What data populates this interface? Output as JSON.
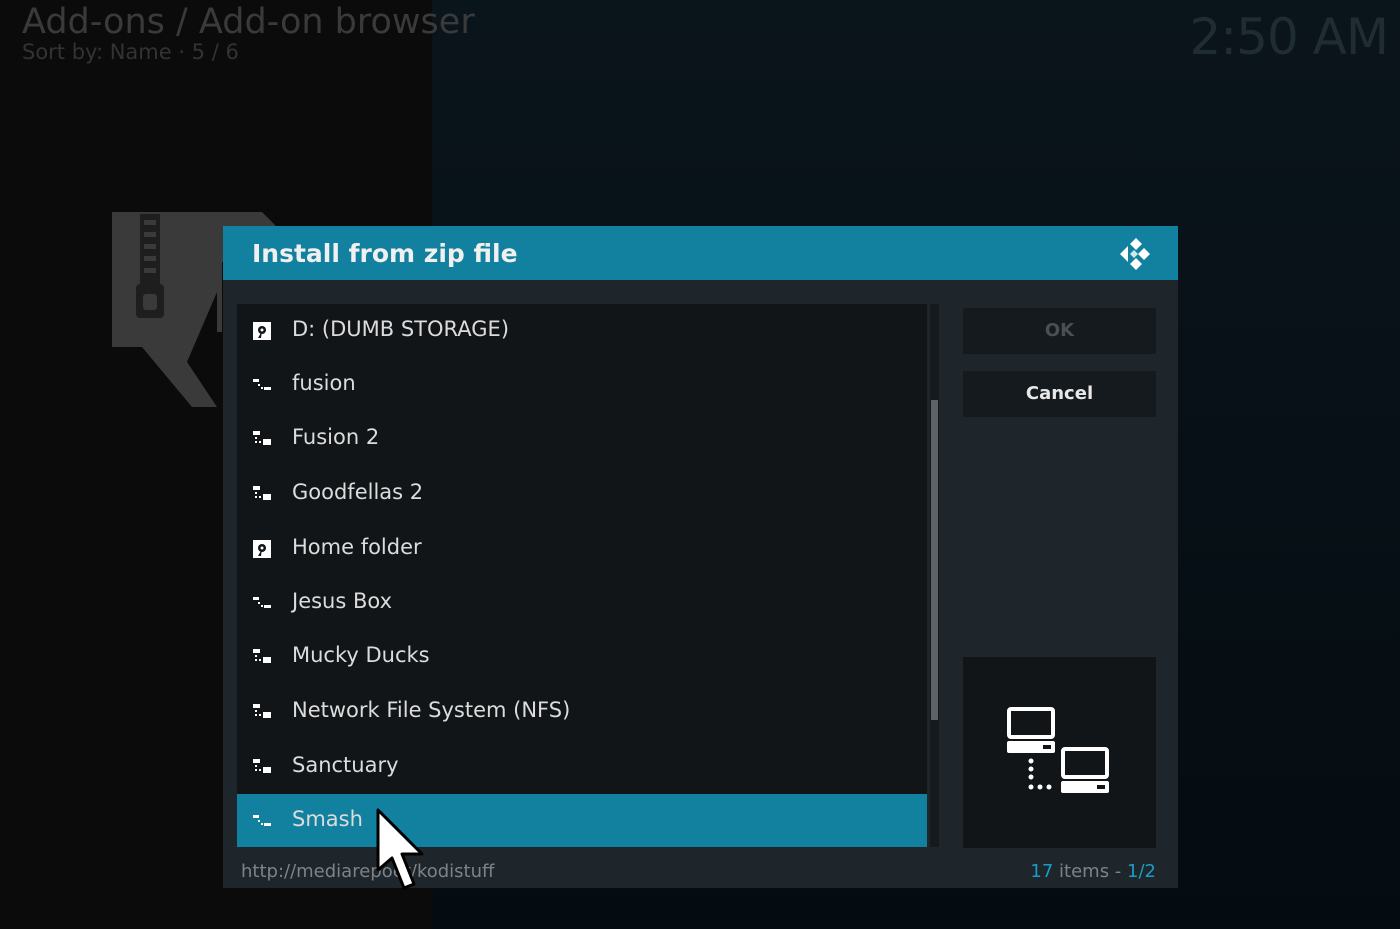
{
  "header": {
    "title": "Add-ons / Add-on browser",
    "subtitle": "Sort by: Name  ·  5 / 6"
  },
  "clock": "2:50 AM",
  "dialog": {
    "title": "Install from zip file",
    "items": [
      {
        "label": "D: (DUMB STORAGE)",
        "icon": "drive-icon"
      },
      {
        "label": "fusion",
        "icon": "network-source-icon"
      },
      {
        "label": "Fusion 2",
        "icon": "network-source-icon"
      },
      {
        "label": "Goodfellas 2",
        "icon": "network-source-icon"
      },
      {
        "label": "Home folder",
        "icon": "drive-icon"
      },
      {
        "label": "Jesus Box",
        "icon": "network-source-icon"
      },
      {
        "label": "Mucky Ducks",
        "icon": "network-source-icon"
      },
      {
        "label": "Network File System (NFS)",
        "icon": "network-source-icon"
      },
      {
        "label": "Sanctuary",
        "icon": "network-source-icon"
      },
      {
        "label": "Smash",
        "icon": "network-source-icon",
        "selected": true
      }
    ],
    "buttons": {
      "ok": "OK",
      "cancel": "Cancel"
    },
    "footer": {
      "path_prefix": "http://mediare",
      "path_hidden": "po",
      "path_suffix": "et/kodistuff",
      "count_number": "17",
      "count_text": " items - ",
      "page": "1/2"
    }
  },
  "colors": {
    "accent": "#12809f",
    "highlight_text": "#1a9cc7"
  }
}
